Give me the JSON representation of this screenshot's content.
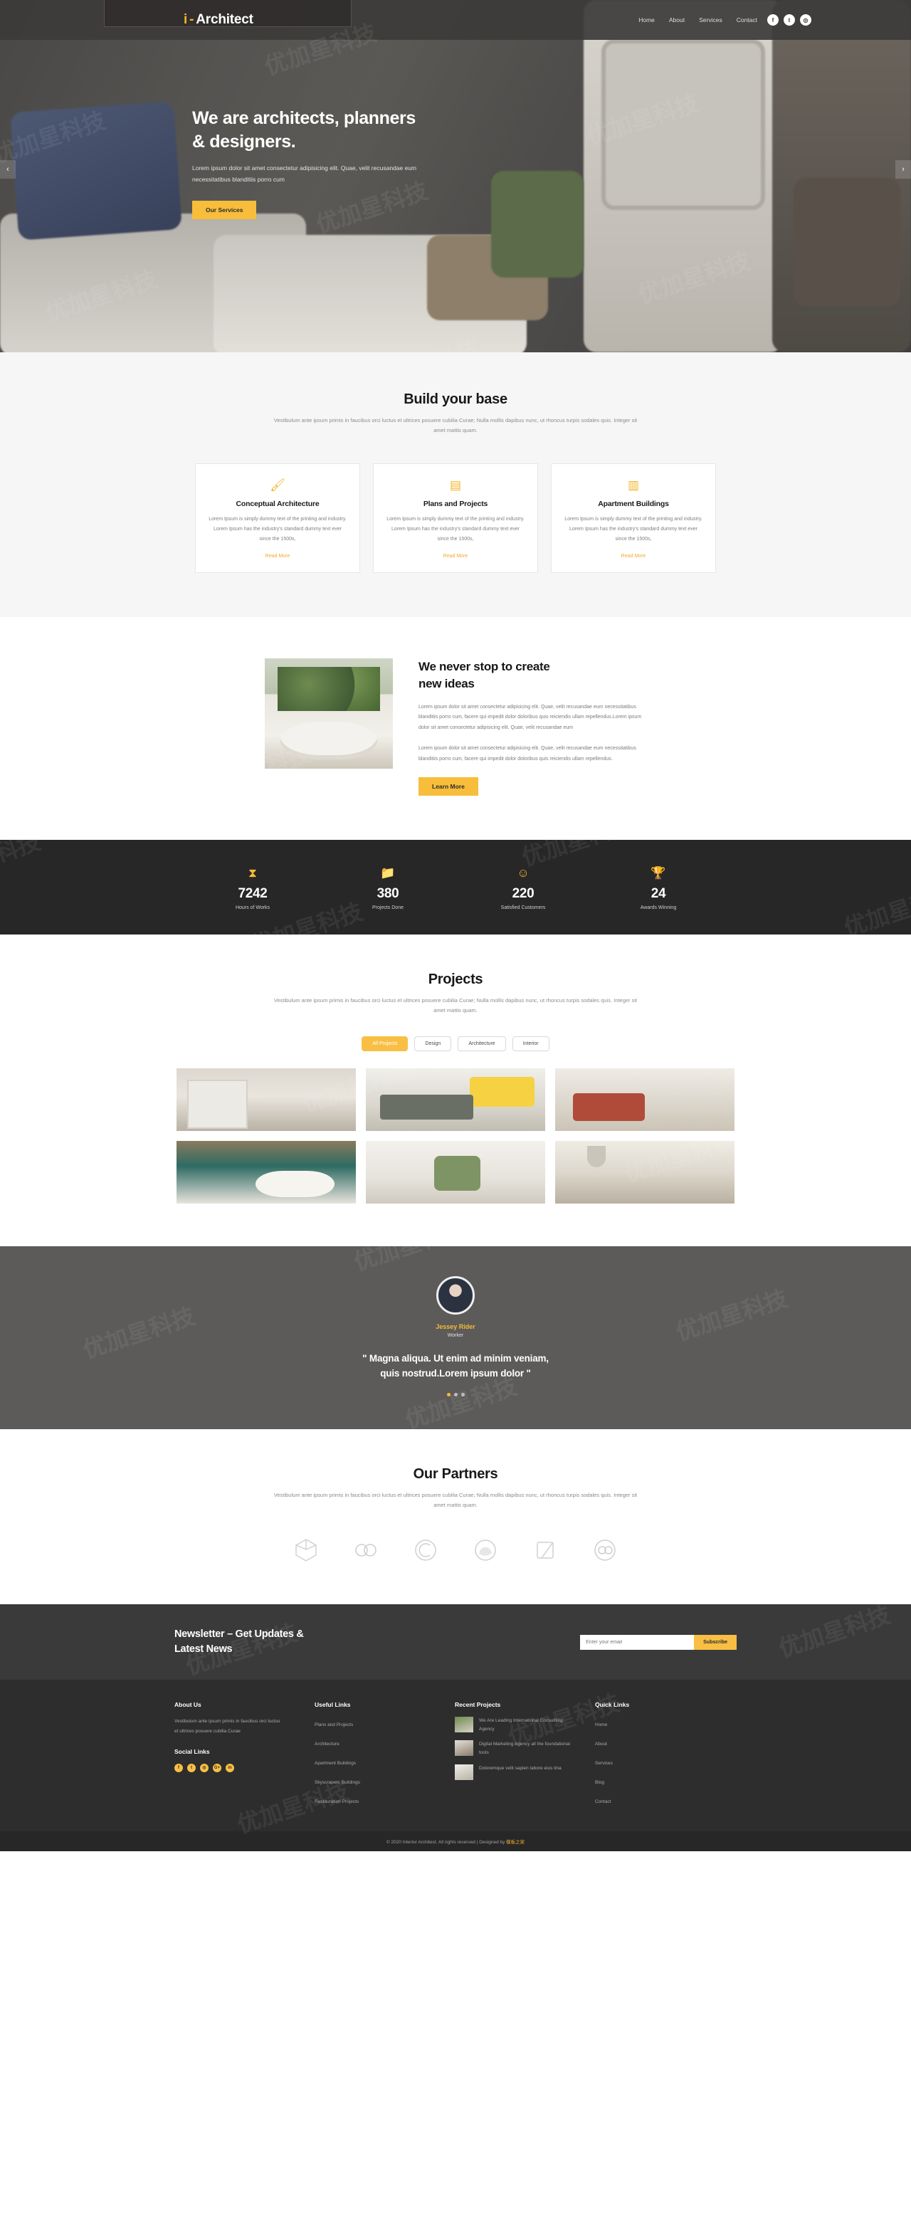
{
  "header": {
    "logo_mark": "i",
    "logo_dash": "-",
    "logo_text": "Architect",
    "nav": [
      {
        "label": "Home"
      },
      {
        "label": "About"
      },
      {
        "label": "Services"
      },
      {
        "label": "Contact"
      }
    ],
    "social": [
      {
        "name": "facebook-icon",
        "glyph": "f"
      },
      {
        "name": "twitter-icon",
        "glyph": "t"
      },
      {
        "name": "instagram-icon",
        "glyph": "◎"
      }
    ]
  },
  "hero": {
    "title_line1": "We are architects, planners",
    "title_line2": "& designers.",
    "paragraph": "Lorem ipsum dolor sit amet consectetur adipisicing elit. Quae, velit recusandae eum necessitatibus blanditiis porro cum",
    "cta": "Our Services",
    "prev": "‹",
    "next": "›"
  },
  "build": {
    "title": "Build your base",
    "subtitle": "Vestibulum ante ipsum primis in faucibus orci luctus et ultrices posuere cubilia Curae; Nulla mollis dapibus nunc, ut rhoncus turpis sodales quis. Integer sit amet mattis quam.",
    "cards": [
      {
        "icon": "paintbrush-icon",
        "glyph": "🖌",
        "title": "Conceptual Architecture",
        "body": "Lorem Ipsum is simply dummy text of the printing and industry. Lorem Ipsum has the industry's standard dummy text ever since the 1500s,",
        "more": "Read More"
      },
      {
        "icon": "blueprint-icon",
        "glyph": "▤",
        "title": "Plans and Projects",
        "body": "Lorem Ipsum is simply dummy text of the printing and industry. Lorem Ipsum has the industry's standard dummy text ever since the 1500s,",
        "more": "Read More"
      },
      {
        "icon": "building-icon",
        "glyph": "▥",
        "title": "Apartment Buildings",
        "body": "Lorem Ipsum is simply dummy text of the printing and industry. Lorem Ipsum has the industry's standard dummy text ever since the 1500s,",
        "more": "Read More"
      }
    ]
  },
  "ideas": {
    "title_line1": "We never stop to create",
    "title_line2": "new ideas",
    "paragraph1": "Lorem ipsum dolor sit amet consectetur adipisicing elit. Quae, velit recusandae eum necessitatibus blanditiis porro cum, facere qui impedit dolor doloribus quis reiciendis ullam repellendus.Lorem ipsum dolor sit amet consectetur adipisicing elit. Quae, velit recusandae eum",
    "paragraph2": "Lorem ipsum dolor sit amet consectetur adipisicing elit. Quae, velit recusandae eum necessitatibus blanditiis porro cum, facere qui impedit dolor doloribus quis reiciendis ullam repellendus.",
    "cta": "Learn More"
  },
  "stats": [
    {
      "icon": "hourglass-icon",
      "glyph": "⧗",
      "number": "7242",
      "label": "Hours of Works"
    },
    {
      "icon": "folder-icon",
      "glyph": "📁",
      "number": "380",
      "label": "Projects Done"
    },
    {
      "icon": "smiley-icon",
      "glyph": "☺",
      "number": "220",
      "label": "Satisfied Customers"
    },
    {
      "icon": "trophy-icon",
      "glyph": "🏆",
      "number": "24",
      "label": "Awards Winning"
    }
  ],
  "projects": {
    "title": "Projects",
    "subtitle": "Vestibulum ante ipsum primis in faucibus orci luctus et ultrices posuere cubilia Curae; Nulla mollis dapibus nunc, ut rhoncus turpis sodales quis. Integer sit amet mattis quam.",
    "filters": [
      {
        "label": "All Projects",
        "active": true
      },
      {
        "label": "Design",
        "active": false
      },
      {
        "label": "Architecture",
        "active": false
      },
      {
        "label": "Interior",
        "active": false
      }
    ],
    "items": [
      {
        "alt": "kitchen-project"
      },
      {
        "alt": "living-room-project"
      },
      {
        "alt": "lounge-project"
      },
      {
        "alt": "bathroom-project"
      },
      {
        "alt": "dining-project"
      },
      {
        "alt": "kitchen-island-project"
      }
    ]
  },
  "testimonial": {
    "name": "Jessey Rider",
    "role": "Worker",
    "quote_line1": "\" Magna aliqua. Ut enim ad minim veniam,",
    "quote_line2": "quis nostrud.Lorem ipsum dolor \"",
    "dots": [
      true,
      false,
      false
    ]
  },
  "partners": {
    "title": "Our Partners",
    "subtitle": "Vestibulum ante ipsum primis in faucibus orci luctus et ultrices posuere cubilia Curae; Nulla mollis dapibus nunc, ut rhoncus turpis sodales quis. Integer sit amet mattis quam.",
    "logos": [
      {
        "name": "cube-outline-logo"
      },
      {
        "name": "double-circle-logo"
      },
      {
        "name": "c-circle-logo"
      },
      {
        "name": "leaf-circle-logo"
      },
      {
        "name": "square-fold-logo"
      },
      {
        "name": "infinity-circle-logo"
      }
    ]
  },
  "newsletter": {
    "title_line1": "Newsletter – Get Updates &",
    "title_line2": "Latest News",
    "placeholder": "Enter your email",
    "button": "Subscribe"
  },
  "footer": {
    "about": {
      "title": "About Us",
      "text": "Vestibulum ante ipsum primis in faucibus orci luctus et ultrices posuere cubilia Curae",
      "social_title": "Social Links",
      "social": [
        {
          "name": "facebook-icon",
          "glyph": "f"
        },
        {
          "name": "twitter-icon",
          "glyph": "t"
        },
        {
          "name": "instagram-icon",
          "glyph": "◎"
        },
        {
          "name": "google-plus-icon",
          "glyph": "G+"
        },
        {
          "name": "linkedin-icon",
          "glyph": "in"
        }
      ]
    },
    "useful": {
      "title": "Useful Links",
      "links": [
        {
          "label": "Plans and Projects"
        },
        {
          "label": "Architecture"
        },
        {
          "label": "Apartment Buildings"
        },
        {
          "label": "Skyscrapers Buildings"
        },
        {
          "label": "Restauration Projects"
        }
      ]
    },
    "recent": {
      "title": "Recent Projects",
      "items": [
        {
          "text": "We Are Leading International Consultiing Agency"
        },
        {
          "text": "Digital Marketing Agency all the foundational tools"
        },
        {
          "text": "Doloremque velit sapien labore eius itna"
        }
      ]
    },
    "quick": {
      "title": "Quick Links",
      "links": [
        {
          "label": "Home"
        },
        {
          "label": "About"
        },
        {
          "label": "Services"
        },
        {
          "label": "Blog"
        },
        {
          "label": "Contact"
        }
      ]
    },
    "copyright_pre": "© 2020 Interior Architect. All rights reserved | Designed by ",
    "copyright_link": "模板之家"
  },
  "watermark": "优加星科技",
  "colors": {
    "accent": "#f9bf44",
    "dark": "#2d2d2d",
    "darker": "#272727",
    "gray_section": "#5d5b59"
  }
}
